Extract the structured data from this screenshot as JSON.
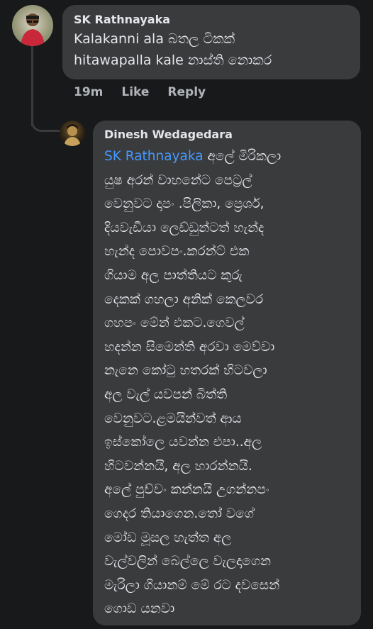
{
  "comments": [
    {
      "author": "SK Rathnayaka",
      "lines": [
        "Kalakanni  ala බතල  ටිකක්",
        "hitawapalla kale නාස්ති  නොකර"
      ],
      "timestamp": "19m",
      "like_label": "Like",
      "reply_label": "Reply"
    },
    {
      "author": "Dinesh Wedagedara",
      "mention": "SK Rathnayaka",
      "first_line_rest": "අලේ මිරිකලා",
      "lines": [
        "යුෂ අරන්  වාහනේට පෙට්‍රල්",
        "වෙනුවට දාපං .පිලිකා, ප්‍රෙශර්,",
        "දියවැඩියා ලෙඩ්ඩුන්ටත් හැන්ද",
        "හැන්ද පොවපං.කරන්ට් එක",
        "ගියාම අල පාත්තියට කුරු",
        "දෙකක් ගහලා අනික් කෙලවර",
        "ගහපං මේන් එකට.ගෙවල්",
        "හදන්න සිමෙන්ති අරවා මෙව්වා",
        "නැනෙ කෝටු හතරක් හිටවලා",
        "අල වැල් යවපන් බිත්ති",
        "වෙනුවට.ළමයින්වත් ආය",
        "ඉස්කෝලෙ යවන්න එපා..අල",
        "හිටවන්නයි, අල හාරන්නයි.",
        "අලේ පුච්චං කන්නයි උගන්නපං",
        "ගෙදර තියාගෙන.තෝ වගේ",
        "මෝඩ මූසල හැත්ත අල",
        "වැල්වලින් බෙල්ලෙ වැලදාගෙන",
        "මැරිලා ගියානම් මේ රට දවසෙන්",
        "ගොඩ යනවා"
      ]
    }
  ]
}
